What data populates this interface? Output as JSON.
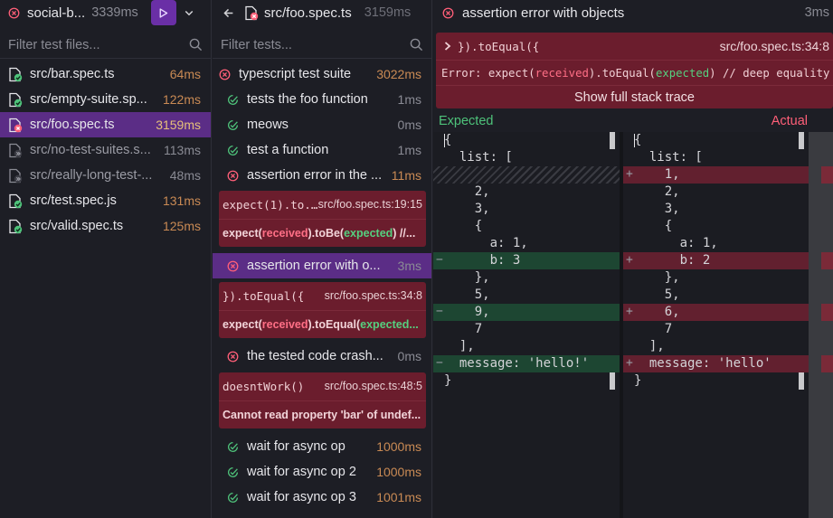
{
  "suite": {
    "name": "social-b...",
    "duration": "3339ms"
  },
  "files": {
    "filter_placeholder": "Filter test files...",
    "items": [
      {
        "name": "src/bar.spec.ts",
        "duration": "64ms",
        "status": "pass"
      },
      {
        "name": "src/empty-suite.sp...",
        "duration": "122ms",
        "status": "pass"
      },
      {
        "name": "src/foo.spec.ts",
        "duration": "3159ms",
        "status": "fail"
      },
      {
        "name": "src/no-test-suites.s...",
        "duration": "113ms",
        "status": "skip"
      },
      {
        "name": "src/really-long-test-...",
        "duration": "48ms",
        "status": "skip"
      },
      {
        "name": "src/test.spec.js",
        "duration": "131ms",
        "status": "pass"
      },
      {
        "name": "src/valid.spec.ts",
        "duration": "125ms",
        "status": "pass"
      }
    ]
  },
  "tests": {
    "file": "src/foo.spec.ts",
    "file_duration": "3159ms",
    "filter_placeholder": "Filter tests...",
    "suite_name": "typescript test suite",
    "suite_duration": "3022ms",
    "items": [
      {
        "name": "tests the foo function",
        "duration": "1ms"
      },
      {
        "name": "meows",
        "duration": "0ms"
      },
      {
        "name": "test a function",
        "duration": "1ms"
      },
      {
        "name": "assertion error in the ...",
        "duration": "11ms"
      },
      {
        "name": "assertion error with o...",
        "duration": "3ms"
      },
      {
        "name": "the tested code crash...",
        "duration": "0ms"
      },
      {
        "name": "wait for async op",
        "duration": "1000ms"
      },
      {
        "name": "wait for async op 2",
        "duration": "1000ms"
      },
      {
        "name": "wait for async op 3",
        "duration": "1001ms"
      }
    ],
    "errors": [
      {
        "frame": "expect(1).to...",
        "location": "src/foo.spec.ts:19:15",
        "message_prefix": "expect(",
        "received": "received",
        "mid": ").toBe(",
        "expected": "expected",
        "suffix": ") //..."
      },
      {
        "frame": "}).toEqual({",
        "location": "src/foo.spec.ts:34:8",
        "message_prefix": "expect(",
        "received": "received",
        "mid": ").toEqual(",
        "expected": "expected...",
        "suffix": ""
      },
      {
        "frame": "doesntWork()",
        "location": "src/foo.spec.ts:48:5",
        "message": "Cannot read property 'bar' of undef..."
      }
    ]
  },
  "detail": {
    "title": "assertion error with objects",
    "duration": "3ms",
    "frame": "}).toEqual({",
    "location": "src/foo.spec.ts:34:8",
    "error_prefix": "Error: expect(",
    "received": "received",
    "error_mid": ").toEqual(",
    "expected": "expected",
    "error_suffix": ") // deep equality",
    "stack_button": "Show full stack trace",
    "expected_label": "Expected",
    "actual_label": "Actual",
    "expected_lines": [
      "{",
      "  list: [",
      "",
      "    2,",
      "    3,",
      "    {",
      "      a: 1,",
      "      b: 3",
      "    },",
      "    5,",
      "    9,",
      "    7",
      "  ],",
      "  message: 'hello!'",
      "}"
    ],
    "actual_lines": [
      "{",
      "  list: [",
      "    1,",
      "    2,",
      "    3,",
      "    {",
      "      a: 1,",
      "      b: 2",
      "    },",
      "    5,",
      "    6,",
      "    7",
      "  ],",
      "  message: 'hello'",
      "}"
    ],
    "expected_marks": [
      "",
      "",
      "gap",
      "",
      "",
      "",
      "",
      "-",
      "",
      "",
      "-",
      "",
      "",
      "-",
      ""
    ],
    "actual_marks": [
      "",
      "",
      "+",
      "",
      "",
      "",
      "",
      "+",
      "",
      "",
      "+",
      "",
      "",
      "+",
      ""
    ]
  },
  "colors": {
    "accent": "#5b2d86",
    "pass": "#4ec27a",
    "fail": "#ff5f78",
    "error_bg": "#6b1d2d",
    "added_bg": "#62202f",
    "removed_bg": "#1d4632"
  }
}
